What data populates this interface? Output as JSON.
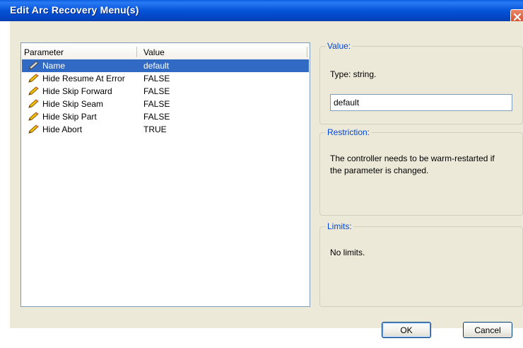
{
  "window": {
    "title": "Edit Arc Recovery Menu(s)"
  },
  "table": {
    "columns": [
      "Parameter",
      "Value"
    ],
    "rows": [
      {
        "name": "Name",
        "value": "default",
        "selected": true
      },
      {
        "name": "Hide Resume At Error",
        "value": "FALSE"
      },
      {
        "name": "Hide Skip Forward",
        "value": "FALSE"
      },
      {
        "name": "Hide Skip Seam",
        "value": "FALSE"
      },
      {
        "name": "Hide Skip Part",
        "value": "FALSE"
      },
      {
        "name": "Hide Abort",
        "value": "TRUE"
      }
    ]
  },
  "value_group": {
    "legend": "Value:",
    "type_text": "Type: string.",
    "input_value": "default"
  },
  "restriction_group": {
    "legend": "Restriction:",
    "line1": "The controller needs to be warm-restarted if",
    "line2": "the parameter is changed."
  },
  "limits_group": {
    "legend": "Limits:",
    "text": "No limits."
  },
  "buttons": {
    "ok": "OK",
    "cancel": "Cancel"
  },
  "icons": {
    "row_icon": "pencil-icon",
    "close": "close-icon"
  },
  "colors": {
    "titlebar": "#0553d8",
    "selection": "#316ac5",
    "dialog_bg": "#ece9d8",
    "group_legend": "#0046d5",
    "close_button": "#d4451f"
  }
}
